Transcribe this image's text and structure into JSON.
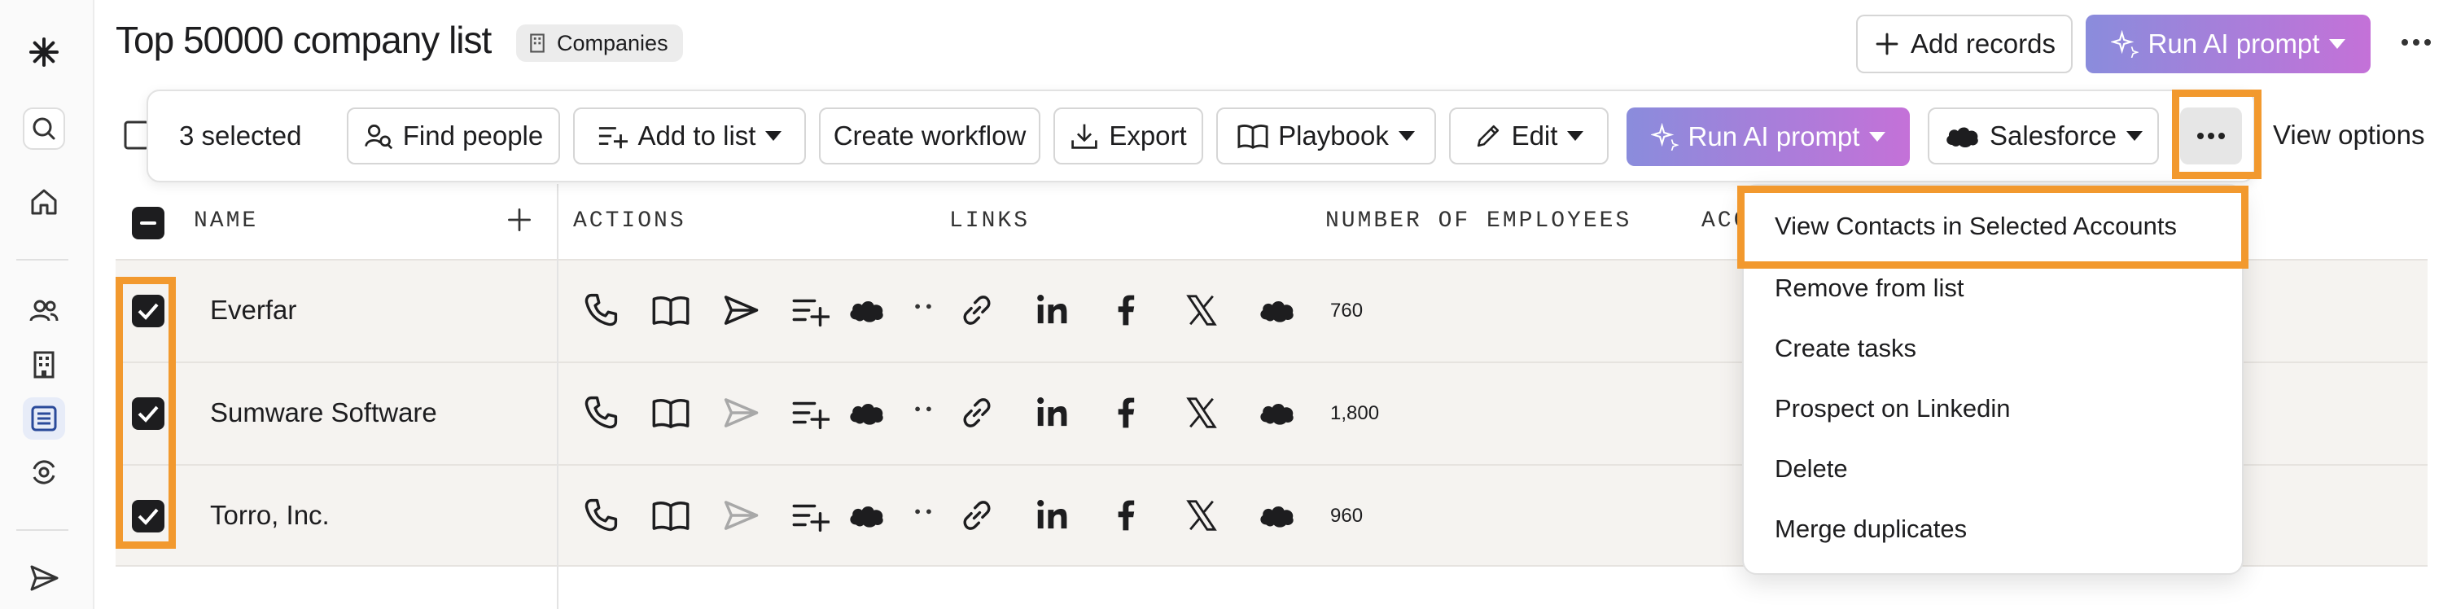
{
  "header": {
    "title": "Top 50000 company list",
    "chip_label": "Companies",
    "add_records_label": "Add records",
    "run_ai_label": "Run AI prompt"
  },
  "action_bar": {
    "selected_label": "3 selected",
    "find_people_label": "Find people",
    "add_to_list_label": "Add to list",
    "create_workflow_label": "Create workflow",
    "export_label": "Export",
    "playbook_label": "Playbook",
    "edit_label": "Edit",
    "run_ai_label": "Run AI prompt",
    "salesforce_label": "Salesforce",
    "view_options_label": "View options"
  },
  "table": {
    "columns": [
      "NAME",
      "ACTIONS",
      "LINKS",
      "NUMBER OF EMPLOYEES",
      "ACC"
    ],
    "rows": [
      {
        "name": "Everfar",
        "employees": "760",
        "selected": true
      },
      {
        "name": "Sumware Software",
        "employees": "1,800",
        "selected": true
      },
      {
        "name": "Torro, Inc.",
        "employees": "960",
        "selected": true
      }
    ]
  },
  "more_menu": {
    "items": [
      "View Contacts in Selected Accounts",
      "Remove from list",
      "Create tasks",
      "Prospect on Linkedin",
      "Delete",
      "Merge duplicates"
    ]
  },
  "colors": {
    "highlight": "#f2992e",
    "ai_gradient_start": "#8a8cdc",
    "ai_gradient_end": "#c471d8",
    "row_background": "#f5f3f0"
  }
}
